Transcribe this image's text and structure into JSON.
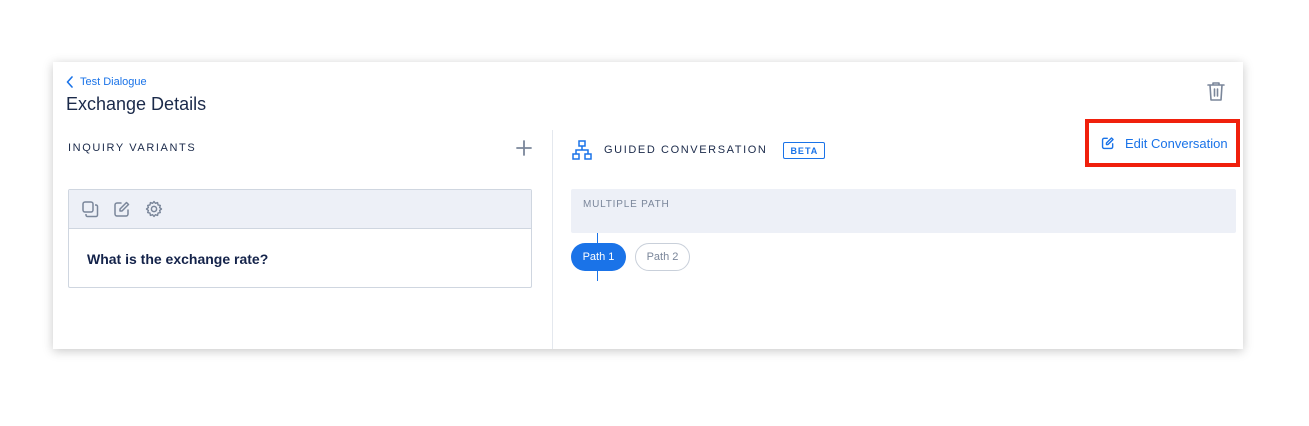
{
  "header": {
    "back_label": "Test Dialogue",
    "title": "Exchange Details",
    "delete_icon": "trash-icon"
  },
  "inquiry": {
    "section_title": "INQUIRY VARIANTS",
    "add_icon": "plus-icon",
    "toolbar_icons": [
      "copy-icon",
      "edit-icon",
      "gear-icon"
    ],
    "variants": [
      {
        "text": "What is the exchange rate?"
      }
    ]
  },
  "guided": {
    "section_title": "GUIDED CONVERSATION",
    "badge": "BETA",
    "icon": "sitemap-icon",
    "edit_label": "Edit Conversation",
    "multiple_path_label": "MULTIPLE PATH",
    "paths": [
      {
        "label": "Path 1",
        "active": true
      },
      {
        "label": "Path 2",
        "active": false
      }
    ]
  },
  "colors": {
    "accent": "#1a73e8",
    "highlight_border": "#f0200c",
    "panel_bg": "#edf0f7",
    "text_dark": "#1b2a4a"
  }
}
